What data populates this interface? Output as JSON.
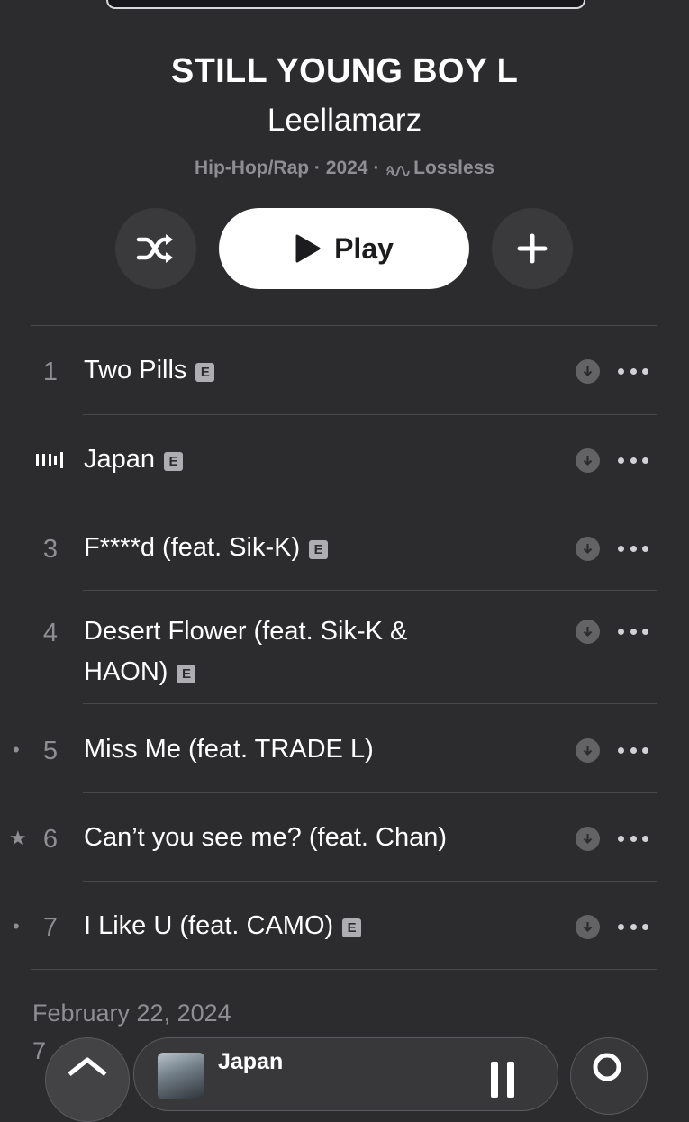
{
  "album": {
    "title": "STILL YOUNG BOY L",
    "artist": "Leellamarz",
    "genre_year": "Hip-Hop/Rap · 2024 ·",
    "quality": "Lossless"
  },
  "actions": {
    "shuffle_icon": "shuffle-icon",
    "play_label": "Play",
    "add_icon": "plus-icon"
  },
  "tracks": [
    {
      "number": "1",
      "title": "Two Pills",
      "explicit": "E",
      "marker": ""
    },
    {
      "number": "",
      "title": "Japan",
      "explicit": "E",
      "marker": "",
      "now_playing": true
    },
    {
      "number": "3",
      "title": "F****d (feat. Sik-K)",
      "explicit": "E",
      "marker": ""
    },
    {
      "number": "4",
      "title": "Desert Flower (feat. Sik-K & HAON)",
      "explicit": "E",
      "marker": ""
    },
    {
      "number": "5",
      "title": "Miss Me (feat. TRADE L)",
      "explicit": "",
      "marker": "•"
    },
    {
      "number": "6",
      "title": "Can’t you see me? (feat. Chan)",
      "explicit": "",
      "marker": "★"
    },
    {
      "number": "7",
      "title": "I Like U (feat. CAMO)",
      "explicit": "E",
      "marker": "•"
    }
  ],
  "footer": {
    "release_date": "February 22, 2024",
    "songs_partial": "7"
  },
  "mini_player": {
    "title": "Japan"
  },
  "colors": {
    "background": "#2c2c2e",
    "secondary_text": "#8e8e93",
    "button_bg": "#3a3a3c"
  }
}
